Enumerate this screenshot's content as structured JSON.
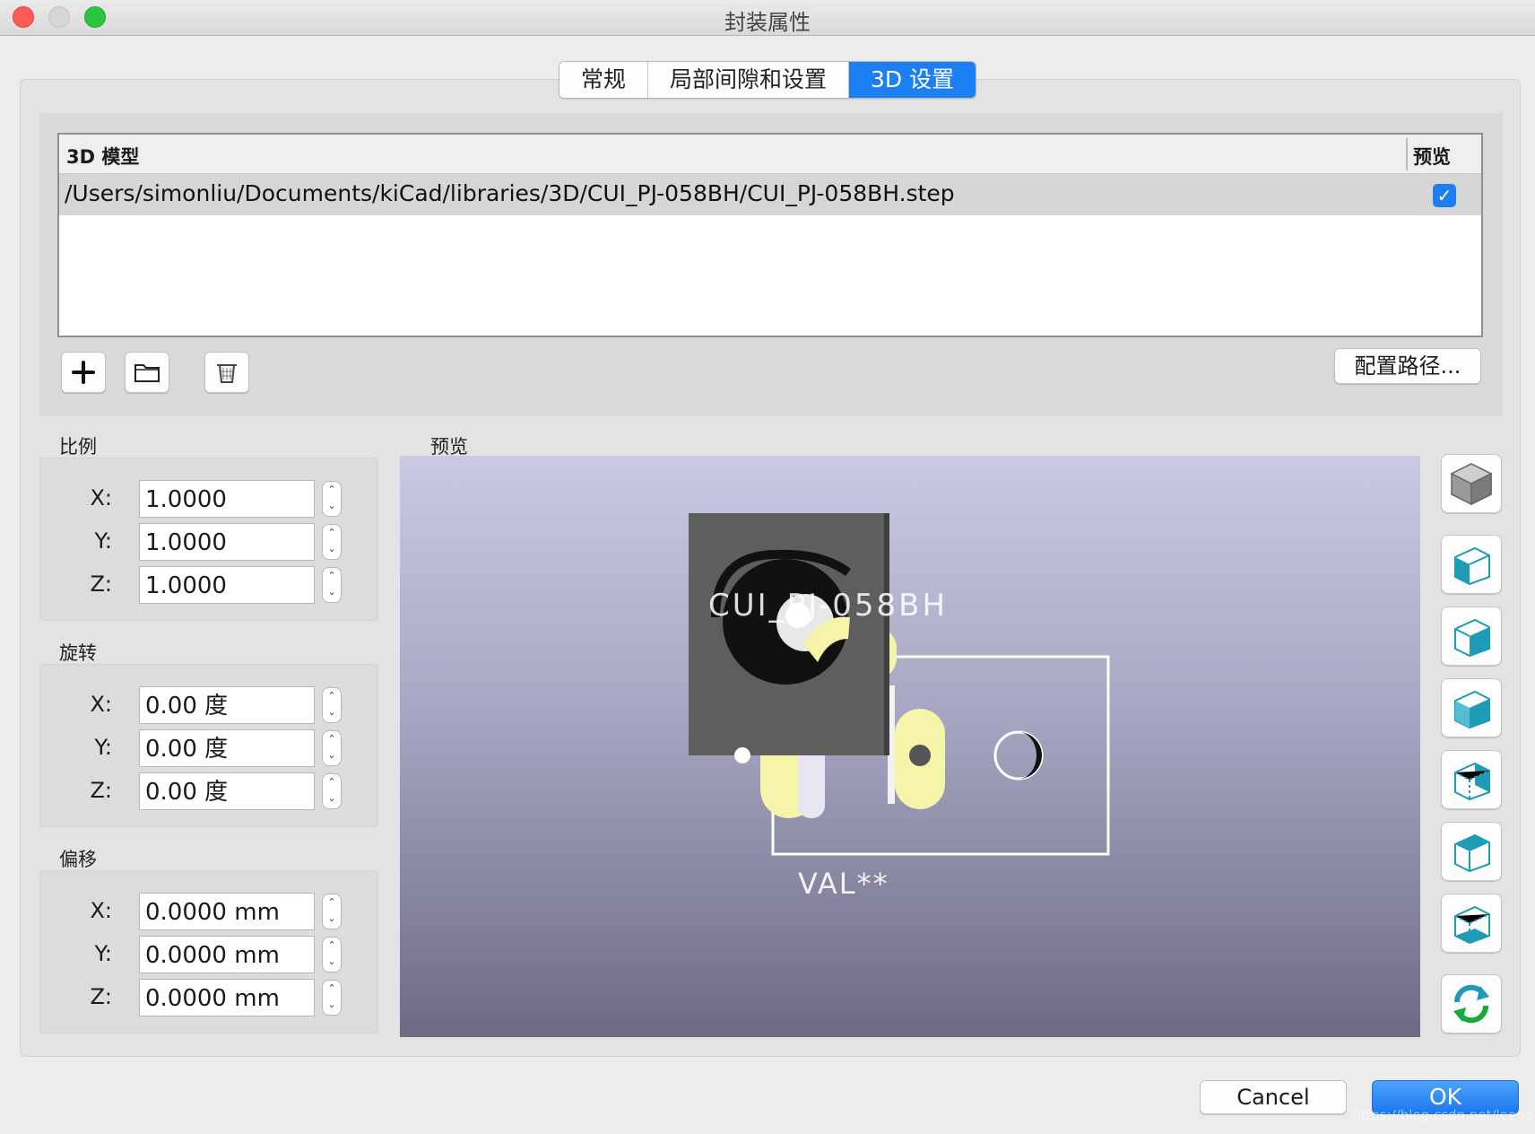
{
  "window": {
    "title": "封装属性"
  },
  "tabs": [
    {
      "label": "常规",
      "active": false
    },
    {
      "label": "局部间隙和设置",
      "active": false
    },
    {
      "label": "3D 设置",
      "active": true
    }
  ],
  "models_table": {
    "col_model": "3D 模型",
    "col_preview": "预览",
    "rows": [
      {
        "path": "/Users/simonliu/Documents/kiCad/libraries/3D/CUI_PJ-058BH/CUI_PJ-058BH.step",
        "preview_checked": true,
        "check_glyph": "✓"
      }
    ]
  },
  "model_toolbar": {
    "add_icon": "plus-icon",
    "open_icon": "folder-icon",
    "delete_icon": "trash-icon",
    "config_paths_label": "配置路径..."
  },
  "scale": {
    "label": "比例",
    "x_label": "X:",
    "x": "1.0000",
    "y_label": "Y:",
    "y": "1.0000",
    "z_label": "Z:",
    "z": "1.0000"
  },
  "rotation": {
    "label": "旋转",
    "x_label": "X:",
    "x": "0.00 度",
    "y_label": "Y:",
    "y": "0.00 度",
    "z_label": "Z:",
    "z": "0.00 度"
  },
  "offset": {
    "label": "偏移",
    "x_label": "X:",
    "x": "0.0000 mm",
    "y_label": "Y:",
    "y": "0.0000 mm",
    "z_label": "Z:",
    "z": "0.0000 mm"
  },
  "preview": {
    "label": "预览",
    "ref_text": "CUI_PJ-058BH",
    "value_text": "VAL**",
    "bg_top": "#c9c9e3",
    "bg_bottom": "#6d6a84",
    "silkscreen_color": "#ffffff",
    "pad_color": "#f6f4a8",
    "body_color": "#5e5e5e"
  },
  "view_buttons": [
    {
      "icon": "view-3d-cube-icon"
    },
    {
      "icon": "view-left-cube-icon"
    },
    {
      "icon": "view-right-cube-icon"
    },
    {
      "icon": "view-front-cube-icon"
    },
    {
      "icon": "view-back-cube-icon"
    },
    {
      "icon": "view-top-cube-icon"
    },
    {
      "icon": "view-bottom-cube-icon"
    },
    {
      "icon": "reload-icon"
    }
  ],
  "footer": {
    "cancel_label": "Cancel",
    "ok_label": "OK",
    "watermark": "https://blog.csdn.net/leepo"
  },
  "accent_color": "#1d80f2",
  "view_icon_color": "#1e9bb5"
}
